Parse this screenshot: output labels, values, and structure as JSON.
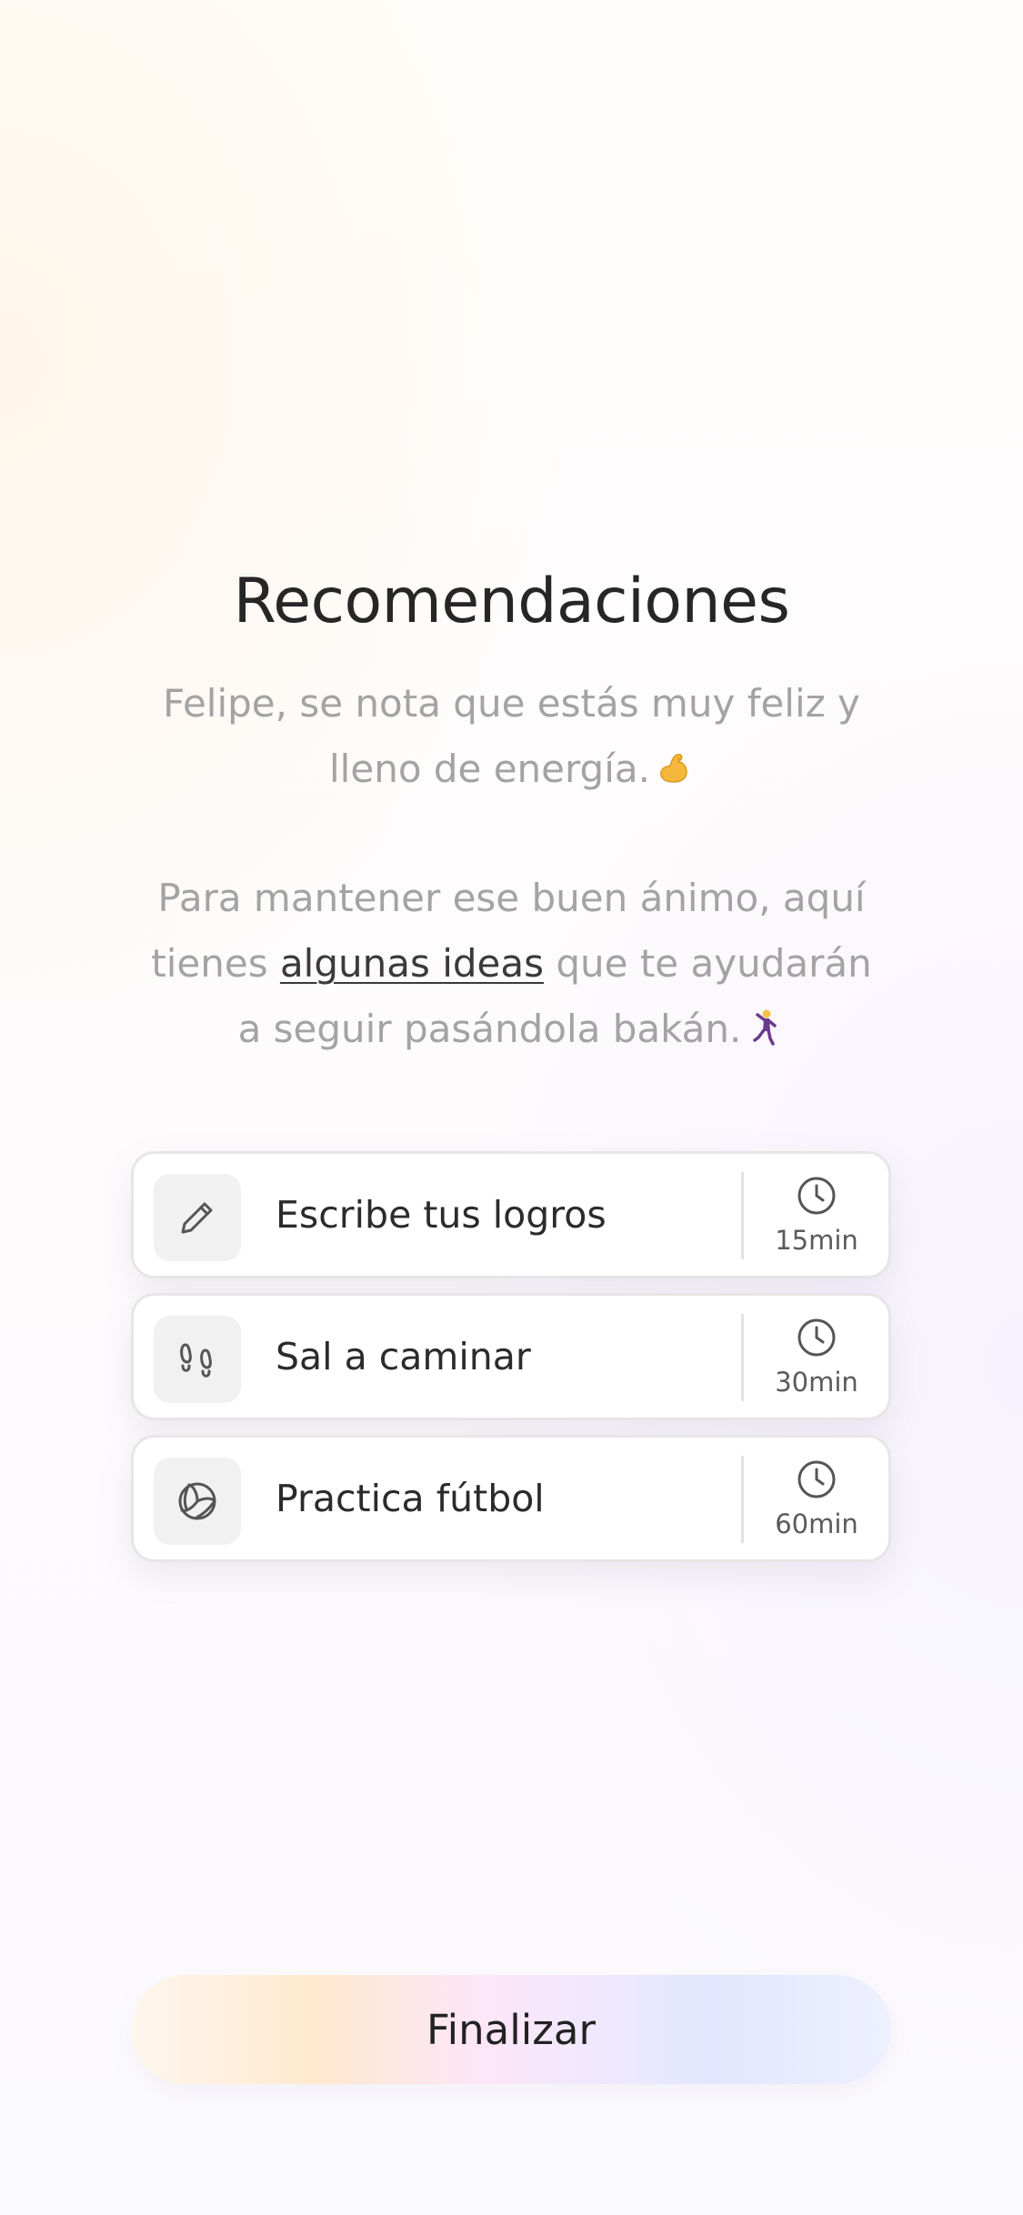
{
  "header": {
    "title": "Recomendaciones",
    "subtitle": "Felipe, se nota que estás muy feliz y lleno de energía."
  },
  "message": {
    "text_before": "Para mantener ese buen ánimo, aquí tienes ",
    "link_text": "algunas ideas",
    "text_after": " que te ayudarán a seguir pasándola bakán."
  },
  "recommendations": [
    {
      "icon": "pencil-icon",
      "label": "Escribe tus logros",
      "duration": "15min"
    },
    {
      "icon": "footprints-icon",
      "label": "Sal a caminar",
      "duration": "30min"
    },
    {
      "icon": "volleyball-icon",
      "label": "Practica fútbol",
      "duration": "60min"
    }
  ],
  "footer": {
    "finish_label": "Finalizar"
  },
  "colors": {
    "title": "#262626",
    "muted_text": "#a3a3a3",
    "card_border": "#e6e6e6",
    "icon_bg": "#f1f1f1"
  }
}
